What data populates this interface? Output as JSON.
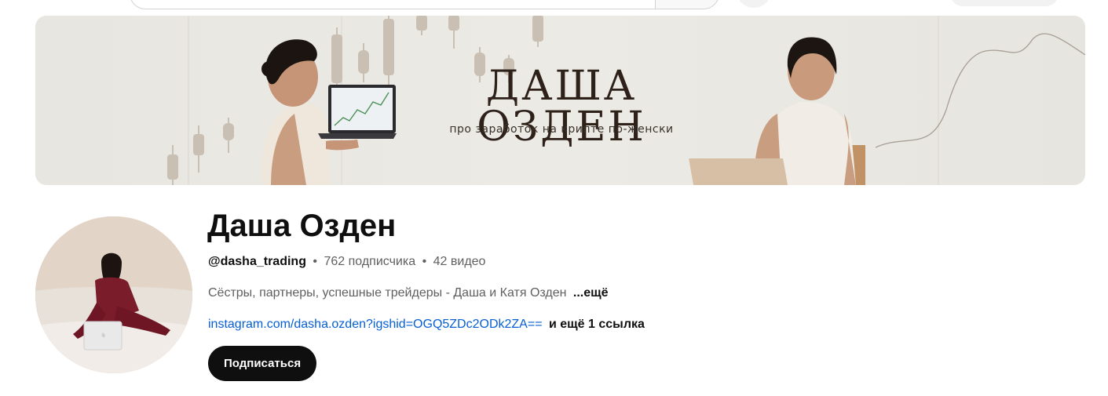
{
  "banner": {
    "title": "ДАША ОЗДЕН",
    "subtitle": "про заработок на крипте по-женски"
  },
  "channel": {
    "name": "Даша Озден",
    "handle": "@dasha_trading",
    "subscribers": "762 подписчика",
    "videos": "42 видео",
    "separator": "•",
    "description": "Сёстры, партнеры, успешные трейдеры - Даша и Катя Озден",
    "description_more": "...ещё",
    "link": "instagram.com/dasha.ozden?igshid=OGQ5ZDc2ODk2ZA==",
    "more_links": "и ещё 1 ссылка",
    "subscribe_label": "Подписаться"
  },
  "colors": {
    "subscribe_bg": "#0f0f0f",
    "link": "#065fd4",
    "banner_bg": "#e9e7e1"
  }
}
